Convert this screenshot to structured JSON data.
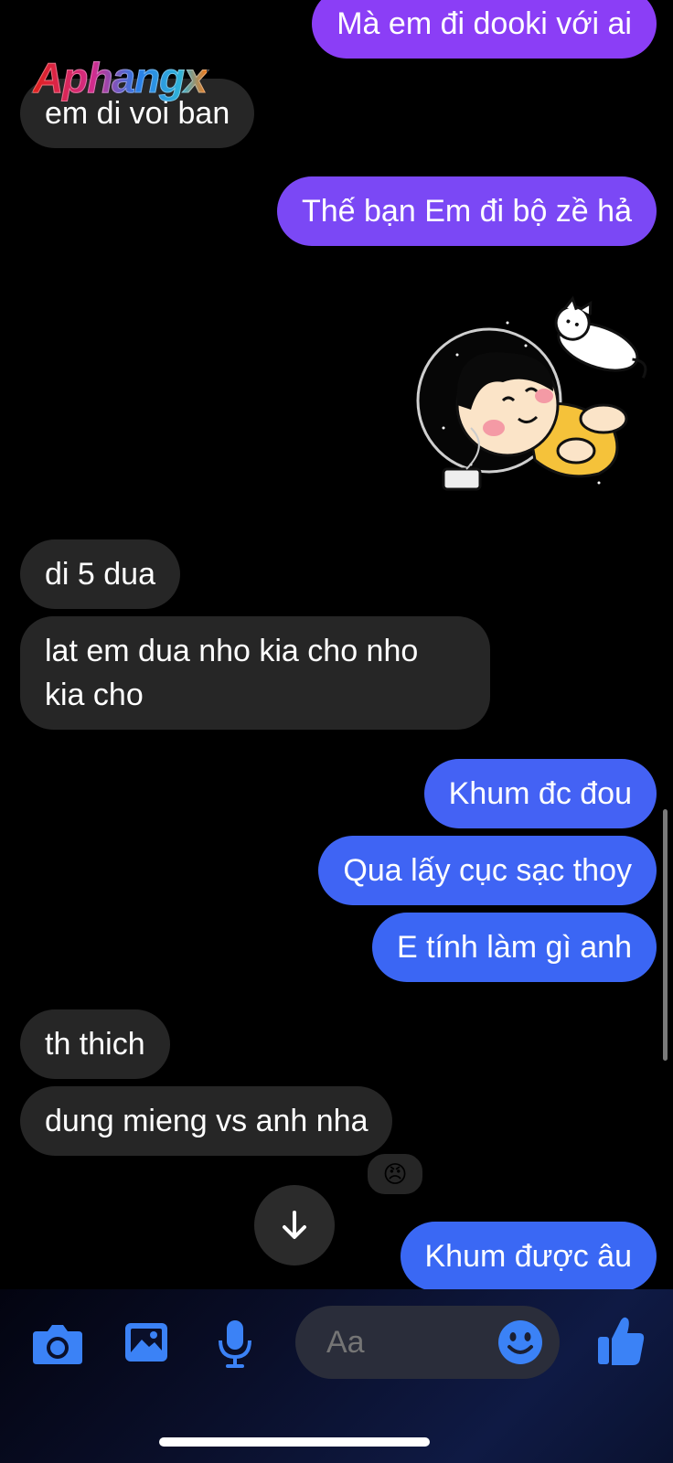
{
  "watermark": "Aphangx",
  "messages": [
    {
      "id": "m1",
      "side": "sent",
      "text": "Mà em đi dooki với ai"
    },
    {
      "id": "m2",
      "side": "received",
      "text": "em di voi ban"
    },
    {
      "id": "m3",
      "side": "sent",
      "text": "Thế bạn Em đi bộ zề hả"
    },
    {
      "id": "m4",
      "side": "received",
      "text": "di 5 dua"
    },
    {
      "id": "m5",
      "side": "received",
      "text": "lat em dua nho kia cho nho kia cho"
    },
    {
      "id": "m6",
      "side": "sent",
      "text": "Khum đc đou"
    },
    {
      "id": "m7",
      "side": "sent",
      "text": "Qua lấy cục sạc thoy"
    },
    {
      "id": "m8",
      "side": "sent",
      "text": "E tính làm gì anh"
    },
    {
      "id": "m9",
      "side": "received",
      "text": "th thich"
    },
    {
      "id": "m10",
      "side": "received",
      "text": "dung mieng vs anh nha"
    },
    {
      "id": "m11",
      "side": "sent",
      "text": "Khum được âu"
    }
  ],
  "reaction": {
    "emoji": "😠"
  },
  "composer": {
    "placeholder": "Aa"
  },
  "icons": {
    "camera": "camera-icon",
    "gallery": "image-icon",
    "mic": "microphone-icon",
    "emoji": "emoji-icon",
    "like": "thumbs-up-icon",
    "scroll_down": "arrow-down-icon"
  },
  "colors": {
    "sent_gradient_top": "#8a3ff5",
    "sent_gradient_bottom": "#3d63f0",
    "received": "#262626",
    "accent": "#3b82f6"
  }
}
